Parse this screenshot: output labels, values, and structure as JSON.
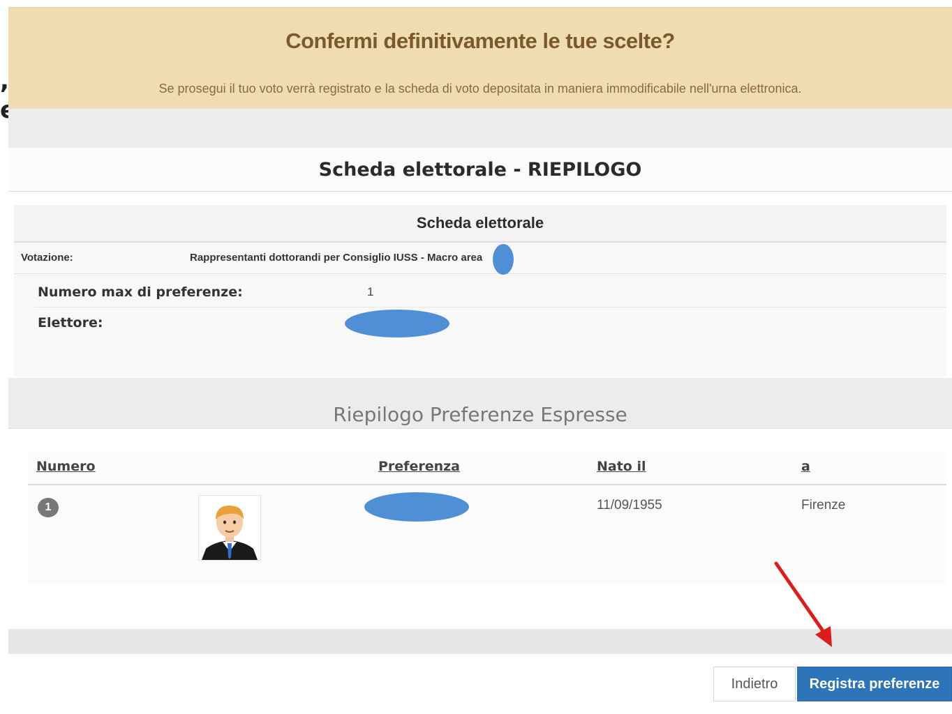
{
  "left_edge_fragments": [
    ",",
    "e"
  ],
  "confirm": {
    "title": "Confermi definitivamente le tue scelte?",
    "subtitle": "Se prosegui il tuo voto verrà registrato e la scheda di voto depositata in maniera immodificabile nell'urna elettronica."
  },
  "summary": {
    "title": "Scheda elettorale - RIEPILOGO"
  },
  "card": {
    "title": "Scheda elettorale",
    "votazione_label": "Votazione:",
    "votazione_value": "Rappresentanti dottorandi per Consiglio IUSS - Macro area",
    "max_pref_label": "Numero max di preferenze:",
    "max_pref_value": "1",
    "elettore_label": "Elettore:"
  },
  "preferences": {
    "title": "Riepilogo Preferenze Espresse",
    "columns": [
      "Numero",
      "Preferenza",
      "Nato il",
      "a"
    ],
    "rows": [
      {
        "numero": "1",
        "nato_il": "11/09/1955",
        "a": "Firenze"
      }
    ]
  },
  "buttons": {
    "back": "Indietro",
    "submit": "Registra preferenze"
  },
  "colors": {
    "banner": "#efdcb0",
    "redaction": "#4f8fd6",
    "primary": "#2e74b8",
    "annotation_arrow": "#e01b1b"
  }
}
